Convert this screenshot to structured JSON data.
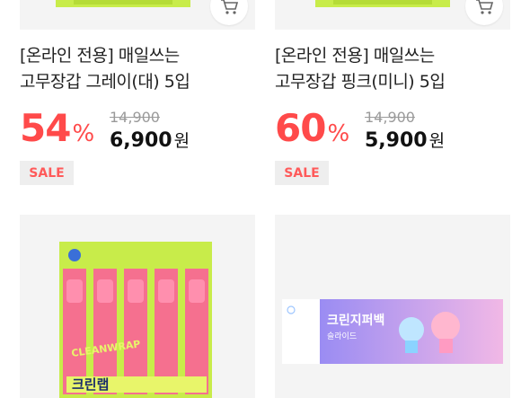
{
  "products": [
    {
      "title_line1": "[온라인 전용] 매일쓰는",
      "title_line2": "고무장갑 그레이(대) 5입",
      "discount_value": "54",
      "discount_unit": "%",
      "original_price": "14,900",
      "sale_price": "6,900",
      "currency": "원",
      "badge": "SALE"
    },
    {
      "title_line1": "[온라인 전용] 매일쓰는",
      "title_line2": "고무장갑 핑크(미니) 5입",
      "discount_value": "60",
      "discount_unit": "%",
      "original_price": "14,900",
      "sale_price": "5,900",
      "currency": "원",
      "badge": "SALE"
    }
  ],
  "lower_products": [
    {
      "image_text_brand": "크린랩",
      "image_text_side": "CLEANWRAP"
    },
    {
      "image_text_brand": "크린지퍼백",
      "image_text_sub": "슬라이드"
    }
  ],
  "icons": {
    "cart": "cart-icon"
  },
  "colors": {
    "discount": "#ff4a4a",
    "badge_text": "#ff5a5a",
    "glove_green": "#c8ec4a",
    "glove_pink": "#f5708f"
  }
}
